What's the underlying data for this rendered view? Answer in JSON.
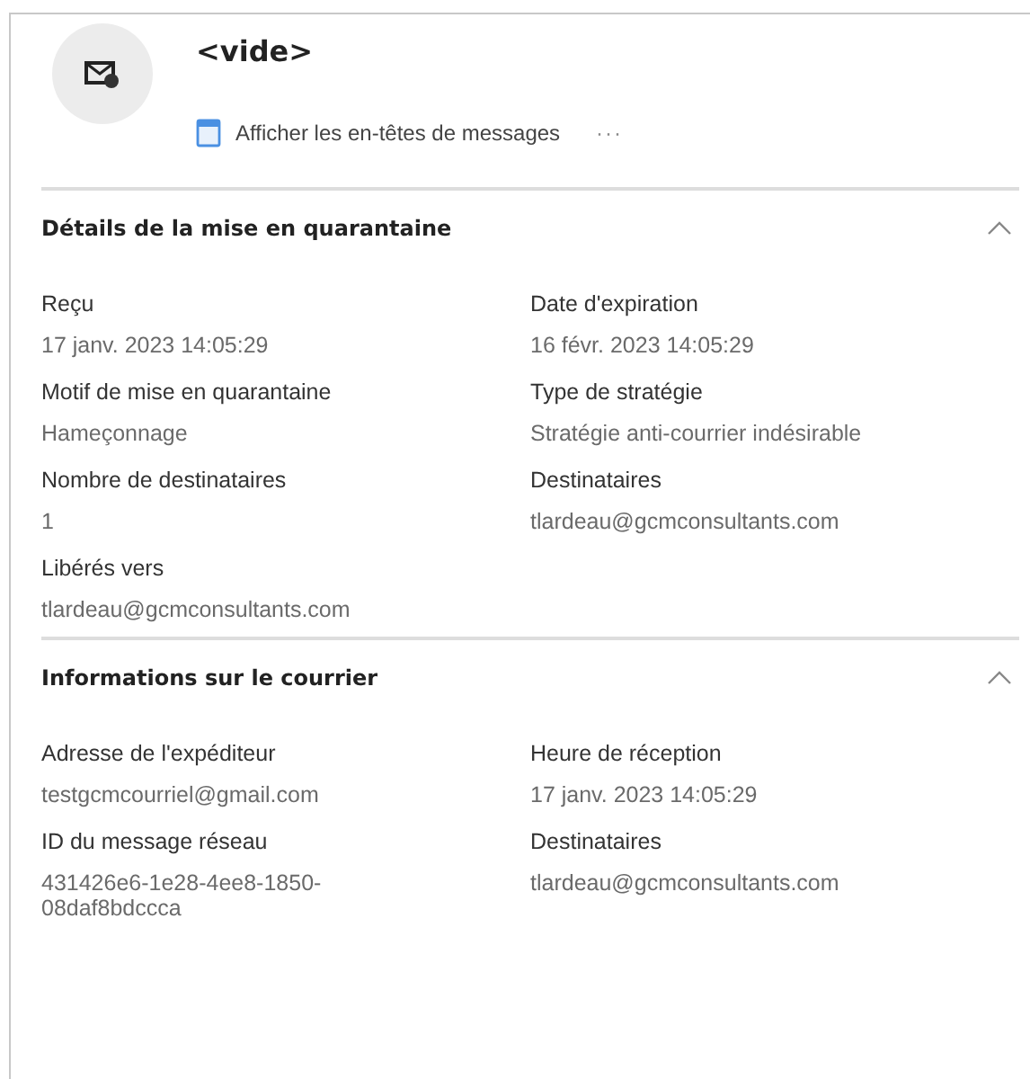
{
  "header": {
    "title": "<vide>",
    "link": "Afficher les en-têtes de messages",
    "more": "···"
  },
  "sections": [
    {
      "title": "Détails de la mise en quarantaine",
      "expanded": true,
      "fields": [
        {
          "label": "Reçu",
          "value": "17 janv. 2023 14:05:29"
        },
        {
          "label": "Date d'expiration",
          "value": "16 févr. 2023 14:05:29"
        },
        {
          "label": "Motif de mise en quarantaine",
          "value": "Hameçonnage"
        },
        {
          "label": "Type de stratégie",
          "value": "Stratégie anti-courrier indésirable"
        },
        {
          "label": "Nombre de destinataires",
          "value": "1"
        },
        {
          "label": "Destinataires",
          "value": "tlardeau@gcmconsultants.com"
        },
        {
          "label": "Libérés vers",
          "value": "tlardeau@gcmconsultants.com"
        }
      ]
    },
    {
      "title": "Informations sur le courrier",
      "expanded": true,
      "fields": [
        {
          "label": "Adresse de l'expéditeur",
          "value": "testgcmcourriel@gmail.com"
        },
        {
          "label": "Heure de réception",
          "value": "17 janv. 2023 14:05:29"
        },
        {
          "label": "ID du message réseau",
          "value": "431426e6-1e28-4ee8-1850-08daf8bdccca"
        },
        {
          "label": "Destinataires",
          "value": "tlardeau@gcmconsultants.com"
        }
      ]
    }
  ]
}
